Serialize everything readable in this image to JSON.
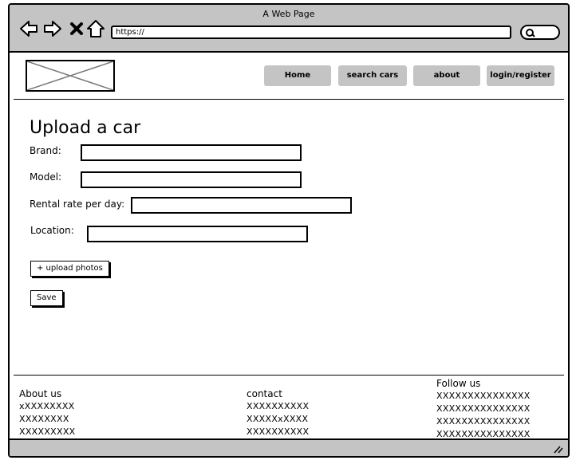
{
  "window": {
    "title": "A Web Page"
  },
  "browser": {
    "url": "https://",
    "icons": [
      "back-arrow-icon",
      "forward-arrow-icon",
      "close-icon",
      "home-icon",
      "search-icon"
    ]
  },
  "header": {
    "logo": "image-placeholder",
    "nav": [
      "Home",
      "search cars",
      "about",
      "login/register"
    ]
  },
  "form": {
    "title": "Upload a car",
    "brand_label": "Brand:",
    "model_label": "Model:",
    "rate_label": "Rental rate per day:",
    "location_label": "Location:",
    "upload_label": "+ upload photos",
    "save_label": "Save"
  },
  "footer": {
    "about": {
      "heading": "About us",
      "lines": [
        "xXXXXXXXX",
        "XXXXXXXX",
        "XXXXXXXXX"
      ]
    },
    "contact": {
      "heading": "contact",
      "lines": [
        "XXXXXXXXXX",
        "XXXXXxXXXX",
        "XXXXXXXXXX"
      ]
    },
    "follow": {
      "heading": "Follow us",
      "lines": [
        "XXXXXXXXXXXXXXX",
        "XXXXXXXXXXXXXXX",
        "XXXXXXXXXXXXXXX",
        "XXXXXXXXXXXXXXX"
      ]
    }
  },
  "colors": {
    "chrome": "#c4c4c4",
    "nav_button": "#c4c4c4",
    "border": "#000000",
    "background": "#ffffff"
  }
}
